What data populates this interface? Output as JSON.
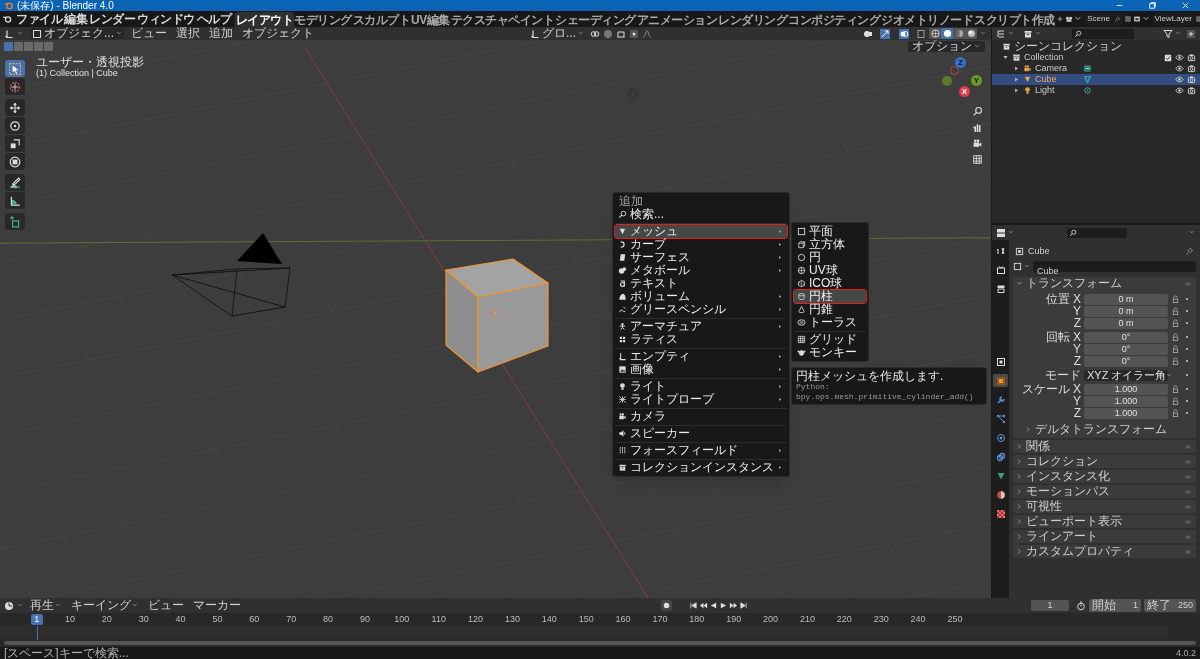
{
  "window": {
    "title": "(未保存) - Blender 4.0"
  },
  "menu_bar": [
    "ファイル",
    "編集",
    "レンダー",
    "ウィンドウ",
    "ヘルプ"
  ],
  "workspaces": [
    {
      "label": "レイアウト",
      "selected": true
    },
    {
      "label": "モデリング",
      "selected": false
    },
    {
      "label": "スカルプト",
      "selected": false
    },
    {
      "label": "UV編集",
      "selected": false
    },
    {
      "label": "テクスチャペイント",
      "selected": false
    },
    {
      "label": "シェーディング",
      "selected": false
    },
    {
      "label": "アニメーション",
      "selected": false
    },
    {
      "label": "レンダリング",
      "selected": false
    },
    {
      "label": "コンポジティング",
      "selected": false
    },
    {
      "label": "ジオメトリノード",
      "selected": false
    },
    {
      "label": "スクリプト作成",
      "selected": false
    }
  ],
  "scene": {
    "name": "Scene"
  },
  "view_layer": {
    "name": "ViewLayer"
  },
  "viewport": {
    "mode": "オブジェク...",
    "menus": [
      "ビュー",
      "選択",
      "追加",
      "オブジェクト"
    ],
    "orientation": "グロ...",
    "options": "オプション",
    "select_modes": [
      {
        "selected": true
      },
      {
        "selected": false
      },
      {
        "selected": false
      },
      {
        "selected": false
      },
      {
        "selected": false
      }
    ],
    "shading": [
      {
        "selected": false
      },
      {
        "selected": true
      },
      {
        "selected": false
      },
      {
        "selected": false
      }
    ],
    "tools": [
      {
        "selected": true
      },
      {
        "selected": false
      },
      {
        "selected": false
      },
      {
        "selected": false
      },
      {
        "selected": false
      },
      {
        "selected": false
      },
      {
        "selected": false
      },
      {
        "selected": false
      },
      {
        "selected": false
      }
    ],
    "view_name": "ユーザー・透視投影",
    "context": "(1) Collection | Cube",
    "gizmo": [
      "Z",
      "Y",
      "X"
    ]
  },
  "add_menu": {
    "title": "追加",
    "groups": [
      [
        {
          "label": "検索...",
          "submenu": false,
          "selected": false,
          "marked": false
        }
      ],
      [
        {
          "label": "メッシュ",
          "submenu": true,
          "selected": true,
          "marked": true
        },
        {
          "label": "カーブ",
          "submenu": true,
          "selected": false,
          "marked": false
        },
        {
          "label": "サーフェス",
          "submenu": true,
          "selected": false,
          "marked": false
        },
        {
          "label": "メタボール",
          "submenu": true,
          "selected": false,
          "marked": false
        },
        {
          "label": "テキスト",
          "submenu": false,
          "selected": false,
          "marked": false
        },
        {
          "label": "ボリューム",
          "submenu": true,
          "selected": false,
          "marked": false
        },
        {
          "label": "グリースペンシル",
          "submenu": true,
          "selected": false,
          "marked": false
        }
      ],
      [
        {
          "label": "アーマチュア",
          "submenu": true,
          "selected": false,
          "marked": false
        },
        {
          "label": "ラティス",
          "submenu": false,
          "selected": false,
          "marked": false
        }
      ],
      [
        {
          "label": "エンプティ",
          "submenu": true,
          "selected": false,
          "marked": false
        },
        {
          "label": "画像",
          "submenu": true,
          "selected": false,
          "marked": false
        }
      ],
      [
        {
          "label": "ライト",
          "submenu": true,
          "selected": false,
          "marked": false
        },
        {
          "label": "ライトプローブ",
          "submenu": true,
          "selected": false,
          "marked": false
        }
      ],
      [
        {
          "label": "カメラ",
          "submenu": false,
          "selected": false,
          "marked": false
        }
      ],
      [
        {
          "label": "スピーカー",
          "submenu": false,
          "selected": false,
          "marked": false
        }
      ],
      [
        {
          "label": "フォースフィールド",
          "submenu": true,
          "selected": false,
          "marked": false
        }
      ],
      [
        {
          "label": "コレクションインスタンス",
          "submenu": true,
          "selected": false,
          "marked": false
        }
      ]
    ]
  },
  "mesh_menu": {
    "groups": [
      [
        {
          "label": "平面",
          "selected": false,
          "marked": false
        },
        {
          "label": "立方体",
          "selected": false,
          "marked": false
        },
        {
          "label": "円",
          "selected": false,
          "marked": false
        },
        {
          "label": "UV球",
          "selected": false,
          "marked": false
        },
        {
          "label": "ICO球",
          "selected": false,
          "marked": false
        },
        {
          "label": "円柱",
          "selected": true,
          "marked": true
        },
        {
          "label": "円錐",
          "selected": false,
          "marked": false
        },
        {
          "label": "トーラス",
          "selected": false,
          "marked": false
        }
      ],
      [
        {
          "label": "グリッド",
          "selected": false,
          "marked": false
        },
        {
          "label": "モンキー",
          "selected": false,
          "marked": false
        }
      ]
    ]
  },
  "tooltip": {
    "text": "円柱メッシュを作成します.",
    "python": "Python: bpy.ops.mesh.primitive_cylinder_add()"
  },
  "outliner": {
    "root": "シーンコレクション",
    "items": [
      {
        "label": "Collection",
        "expanded": true,
        "checked": true,
        "selected": false,
        "children": [
          {
            "label": "Camera",
            "expanded": false,
            "selected": false
          },
          {
            "label": "Cube",
            "expanded": false,
            "selected": true
          },
          {
            "label": "Light",
            "expanded": false,
            "selected": false
          }
        ]
      }
    ]
  },
  "properties": {
    "tabs": [
      {
        "selected": false
      },
      {
        "selected": false
      },
      {
        "selected": false
      },
      {
        "selected": false
      },
      {
        "selected": true
      },
      {
        "selected": false
      },
      {
        "selected": false
      },
      {
        "selected": false
      },
      {
        "selected": false
      },
      {
        "selected": false
      },
      {
        "selected": false
      },
      {
        "selected": false
      }
    ],
    "object": "Cube",
    "data_name": "Cube",
    "panel": {
      "title": "トランスフォーム",
      "expanded": true,
      "rows": [
        {
          "kind": "number",
          "label": "位置 X",
          "value": "0 m"
        },
        {
          "kind": "number",
          "label": "Y",
          "value": "0 m"
        },
        {
          "kind": "number",
          "label": "Z",
          "value": "0 m"
        },
        {
          "kind": "number",
          "label": "回転 X",
          "value": "0°"
        },
        {
          "kind": "number",
          "label": "Y",
          "value": "0°"
        },
        {
          "kind": "number",
          "label": "Z",
          "value": "0°"
        },
        {
          "kind": "dropdown",
          "label": "モード",
          "value": "XYZ オイラー角"
        },
        {
          "kind": "number",
          "label": "スケール X",
          "value": "1.000"
        },
        {
          "kind": "number",
          "label": "Y",
          "value": "1.000"
        },
        {
          "kind": "number",
          "label": "Z",
          "value": "1.000"
        }
      ],
      "subpanel": {
        "title": "デルタトランスフォーム",
        "expanded": false
      }
    },
    "panels": [
      {
        "title": "関係",
        "expanded": false
      },
      {
        "title": "コレクション",
        "expanded": false
      },
      {
        "title": "インスタンス化",
        "expanded": false
      },
      {
        "title": "モーションパス",
        "expanded": false
      },
      {
        "title": "可視性",
        "expanded": false
      },
      {
        "title": "ビューポート表示",
        "expanded": false
      },
      {
        "title": "ラインアート",
        "expanded": false
      },
      {
        "title": "カスタムプロパティ",
        "expanded": false
      }
    ]
  },
  "timeline": {
    "menus": [
      "再生",
      "キーイング",
      "ビュー",
      "マーカー"
    ],
    "current_frame": "1",
    "start_label": "開始",
    "start": "1",
    "end_label": "終了",
    "end": "250",
    "playhead": "1",
    "ruler": [
      "10",
      "20",
      "30",
      "40",
      "50",
      "60",
      "70",
      "80",
      "90",
      "100",
      "110",
      "120",
      "130",
      "140",
      "150",
      "160",
      "170",
      "180",
      "190",
      "200",
      "210",
      "220",
      "230",
      "240",
      "250"
    ]
  },
  "status_bar": {
    "hint": "[スペース]キーで検索...",
    "version": "4.0.2"
  }
}
